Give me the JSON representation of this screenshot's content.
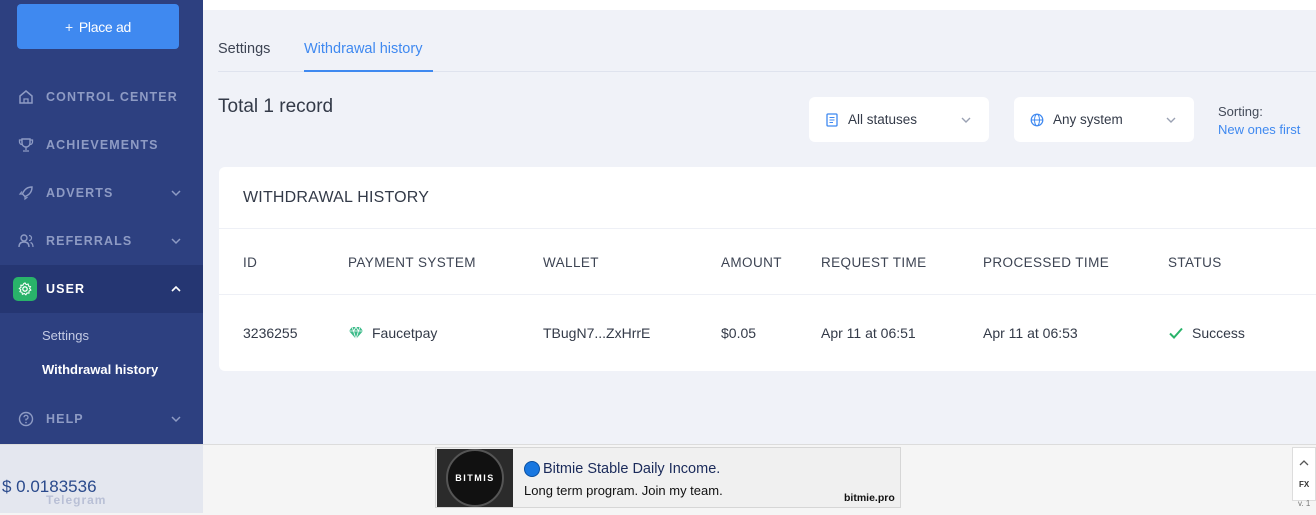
{
  "sidebar": {
    "place_ad": "Place ad",
    "items": [
      {
        "label": "CONTROL CENTER",
        "icon": "home-icon"
      },
      {
        "label": "ACHIEVEMENTS",
        "icon": "trophy-icon"
      },
      {
        "label": "ADVERTS",
        "icon": "rocket-icon"
      },
      {
        "label": "REFERRALS",
        "icon": "users-icon"
      },
      {
        "label": "USER",
        "icon": "gear-icon"
      },
      {
        "label": "HELP",
        "icon": "help-circle-icon"
      }
    ],
    "user_sub": [
      "Settings",
      "Withdrawal history"
    ]
  },
  "tabs": [
    "Settings",
    "Withdrawal history"
  ],
  "total": "Total 1 record",
  "filters": {
    "status": "All statuses",
    "system": "Any system"
  },
  "sorting": {
    "label": "Sorting:",
    "value": "New ones first"
  },
  "table": {
    "title": "WITHDRAWAL HISTORY",
    "headers": [
      "ID",
      "PAYMENT SYSTEM",
      "WALLET",
      "AMOUNT",
      "REQUEST TIME",
      "PROCESSED TIME",
      "STATUS"
    ],
    "rows": [
      {
        "id": "3236255",
        "payment_system": "Faucetpay",
        "wallet": "TBugN7...ZxHrrE",
        "amount": "$0.05",
        "request_time": "Apr 11 at 06:51",
        "processed_time": "Apr 11 at 06:53",
        "status": "Success"
      }
    ]
  },
  "footer": {
    "price": "$ 0.0183536",
    "telegram": "Telegram",
    "ad": {
      "logo_text": "BITMIS",
      "headline": "Bitmie Stable Daily Income.",
      "sub": "Long term program. Join my team.",
      "domain": "bitmie.pro"
    },
    "fx": "FX",
    "version": "v. 1"
  },
  "colors": {
    "sidebar": "#2d4080",
    "accent": "#3f89f0",
    "success": "#29b36a"
  }
}
